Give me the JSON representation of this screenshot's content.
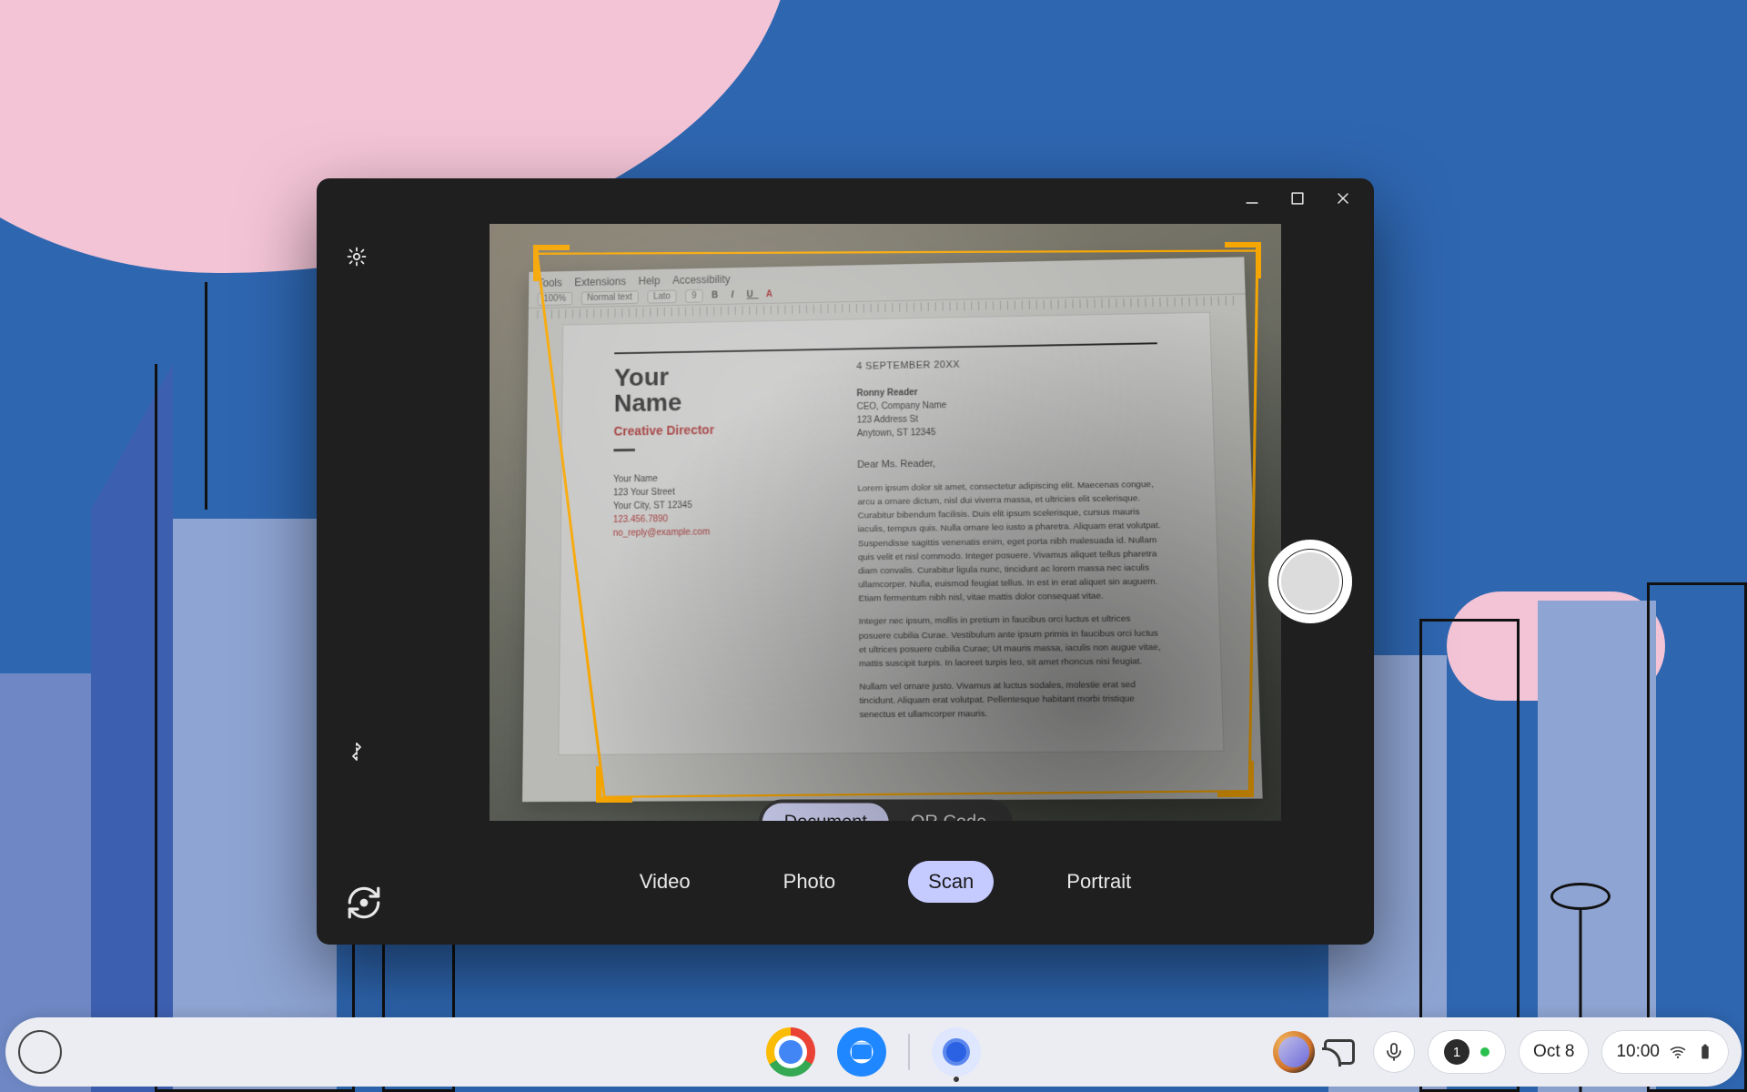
{
  "shelf": {
    "date_label": "Oct 8",
    "time_label": "10:00",
    "notification_count": "1",
    "pinned": {
      "chrome": "chrome-browser-icon",
      "files": "files-app-icon",
      "camera": "camera-app-icon"
    }
  },
  "camera_app": {
    "window_controls": {
      "minimize": "minimize",
      "maximize": "maximize",
      "close": "close"
    },
    "side": {
      "settings": "settings",
      "mirror": "mirror",
      "switch_camera": "switch-camera"
    },
    "modes": {
      "video": "Video",
      "photo": "Photo",
      "scan": "Scan",
      "portrait": "Portrait",
      "active": "scan"
    },
    "scan_submodes": {
      "document": "Document",
      "qr_code": "QR Code",
      "active": "document"
    },
    "shutter": "take-scan"
  },
  "scan_preview": {
    "editor_menu": {
      "tools": "Tools",
      "extensions": "Extensions",
      "help": "Help",
      "accessibility": "Accessibility"
    },
    "toolbar": {
      "zoom": "100%",
      "style": "Normal text",
      "font": "Lato",
      "size": "9"
    },
    "letter": {
      "name_line1": "Your",
      "name_line2": "Name",
      "role": "Creative Director",
      "from_name": "Your Name",
      "from_street": "123 Your Street",
      "from_city": "Your City, ST 12345",
      "from_phone": "123.456.7890",
      "from_email": "no_reply@example.com",
      "date": "4 SEPTEMBER 20XX",
      "to_name": "Ronny Reader",
      "to_title": "CEO, Company Name",
      "to_street": "123 Address St",
      "to_city": "Anytown, ST 12345",
      "salutation": "Dear Ms. Reader,",
      "para1": "Lorem ipsum dolor sit amet, consectetur adipiscing elit. Maecenas congue, arcu a ornare dictum, nisl dui viverra massa, et ultricies elit scelerisque. Curabitur bibendum facilisis. Duis elit ipsum scelerisque, cursus mauris iaculis, tempus quis. Nulla ornare leo iusto a pharetra. Aliquam erat volutpat. Suspendisse sagittis venenatis enim, eget porta nibh malesuada id. Nullam quis velit et nisl commodo. Integer posuere. Vivamus aliquet tellus pharetra diam convalis. Curabitur ligula nunc, tincidunt ac lorem massa nec iaculis ullamcorper. Nulla, euismod feugiat tellus. In est in erat aliquet sin auguem. Etiam fermentum nibh nisl, vitae mattis dolor consequat vitae.",
      "para2": "Integer nec ipsum, mollis in pretium in faucibus orci luctus et ultrices posuere cubilia Curae. Vestibulum ante ipsum primis in faucibus orci luctus et ultrices posuere cubilia Curae; Ut mauris massa, iaculis non augue vitae, mattis suscipit turpis. In laoreet turpis leo, sit amet rhoncus nisi feugiat.",
      "para3": "Nullam vel ornare justo. Vivamus at luctus sodales, molestie erat sed tincidunt. Aliquam erat volutpat. Pellentesque habitant morbi tristique senectus et ullamcorper mauris."
    }
  }
}
